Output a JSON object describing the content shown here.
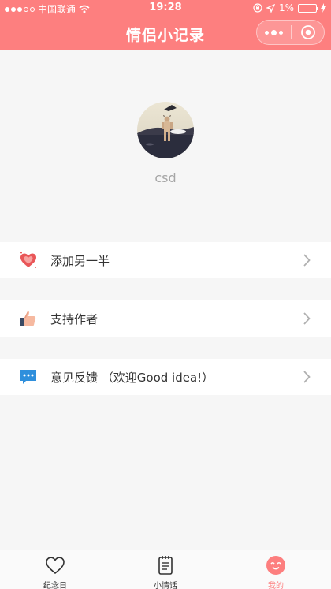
{
  "status_bar": {
    "carrier": "中国联通",
    "time": "19:28",
    "battery": "1%",
    "battery_level": 0.01
  },
  "nav": {
    "title": "情侣小记录",
    "bg_color": "#fd7f7f"
  },
  "profile": {
    "username": "csd"
  },
  "menu": [
    {
      "label": "添加另一半",
      "icon": "hearts-icon"
    },
    {
      "label": "支持作者",
      "icon": "thumbs-up-icon"
    },
    {
      "label": "意见反馈 （欢迎Good idea!）",
      "icon": "chat-bubble-icon"
    }
  ],
  "tabs": [
    {
      "label": "纪念日",
      "icon": "heart-outline-icon",
      "active": false
    },
    {
      "label": "小情话",
      "icon": "notebook-icon",
      "active": false
    },
    {
      "label": "我的",
      "icon": "smiley-face-icon",
      "active": true
    }
  ],
  "colors": {
    "accent": "#fd7f7f",
    "muted_text": "#a6a6a6"
  }
}
